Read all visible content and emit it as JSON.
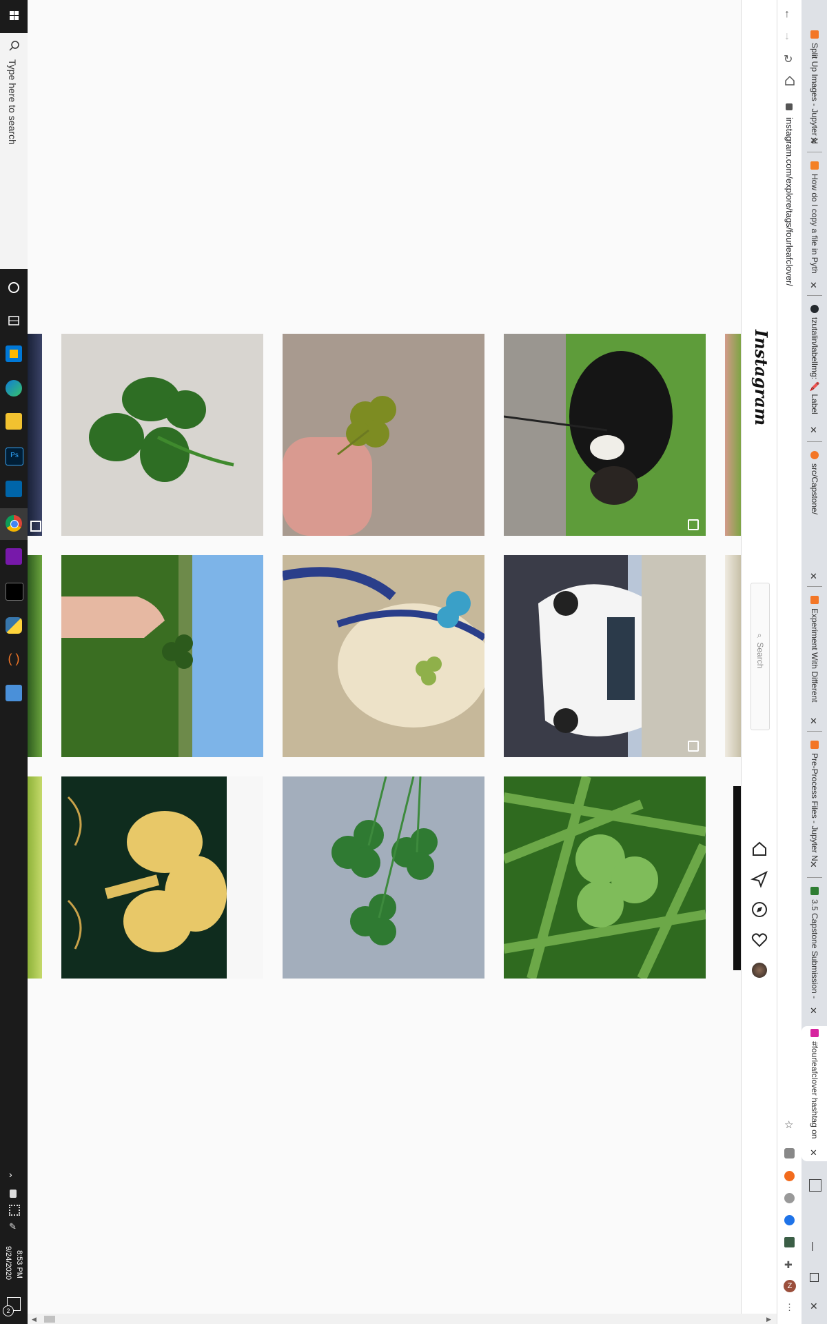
{
  "taskbar": {
    "search_placeholder": "Type here to search",
    "time": "8:53 PM",
    "date": "9/24/2020",
    "notification_count": "2",
    "icons": [
      "windows-icon",
      "cortana-icon",
      "task-view-icon",
      "store-icon",
      "edge-icon",
      "file-explorer-icon",
      "photoshop-icon",
      "vscode-icon",
      "chrome-icon",
      "onenote-icon",
      "terminal-icon",
      "python-icon",
      "jupyter-icon",
      "calculator-icon"
    ]
  },
  "browser": {
    "url": "instagram.com/explore/tags/fourleafclover/",
    "tabs": [
      {
        "title": "Split Up Images - Jupyter N",
        "favicon_color": "#f37626"
      },
      {
        "title": "How do I copy a file in Pyth",
        "favicon_color": "#f48024"
      },
      {
        "title": "tzutalin/labelImg: 🖍️ Label",
        "favicon_color": "#24292e"
      },
      {
        "title": "src/Capstone/",
        "favicon_color": "#f37626"
      },
      {
        "title": "Experiment With Different",
        "favicon_color": "#f37626"
      },
      {
        "title": "Pre-Process Files - Jupyter N",
        "favicon_color": "#f37626"
      },
      {
        "title": "3.5 Capstone Submission -",
        "favicon_color": "#2e7d32"
      },
      {
        "title": "#fourleafclover hashtag on",
        "favicon_color": "#d6249f"
      }
    ],
    "tab_close_glyph": "✕",
    "nav_icons": [
      "back-icon",
      "forward-icon",
      "reload-icon",
      "home-icon"
    ],
    "extension_icons": [
      "star-icon",
      "grammarly-icon",
      "extension-orange-icon",
      "extension-gray-icon",
      "extension-blue-icon",
      "extension-photo-icon",
      "puzzle-icon",
      "profile-icon"
    ],
    "profile_initial": "Z"
  },
  "instagram": {
    "logo": "Instagram",
    "search_placeholder": "Search",
    "nav_icons": [
      "home-icon",
      "direct-icon",
      "explore-icon",
      "activity-heart-icon",
      "profile-avatar-icon"
    ]
  },
  "grid": {
    "rows": [
      [
        "clover-on-stone",
        "four-leaf-clover-held-fingers",
        "dog-on-grass"
      ],
      [
        "hand-picking-clover-field",
        "clover-on-shirt",
        "white-sports-car"
      ],
      [
        "gold-clover-plaque",
        "three-clovers-on-fabric",
        "clover-in-grass"
      ]
    ],
    "multi_post_badges": [
      "dog-on-grass",
      "white-sports-car"
    ]
  }
}
